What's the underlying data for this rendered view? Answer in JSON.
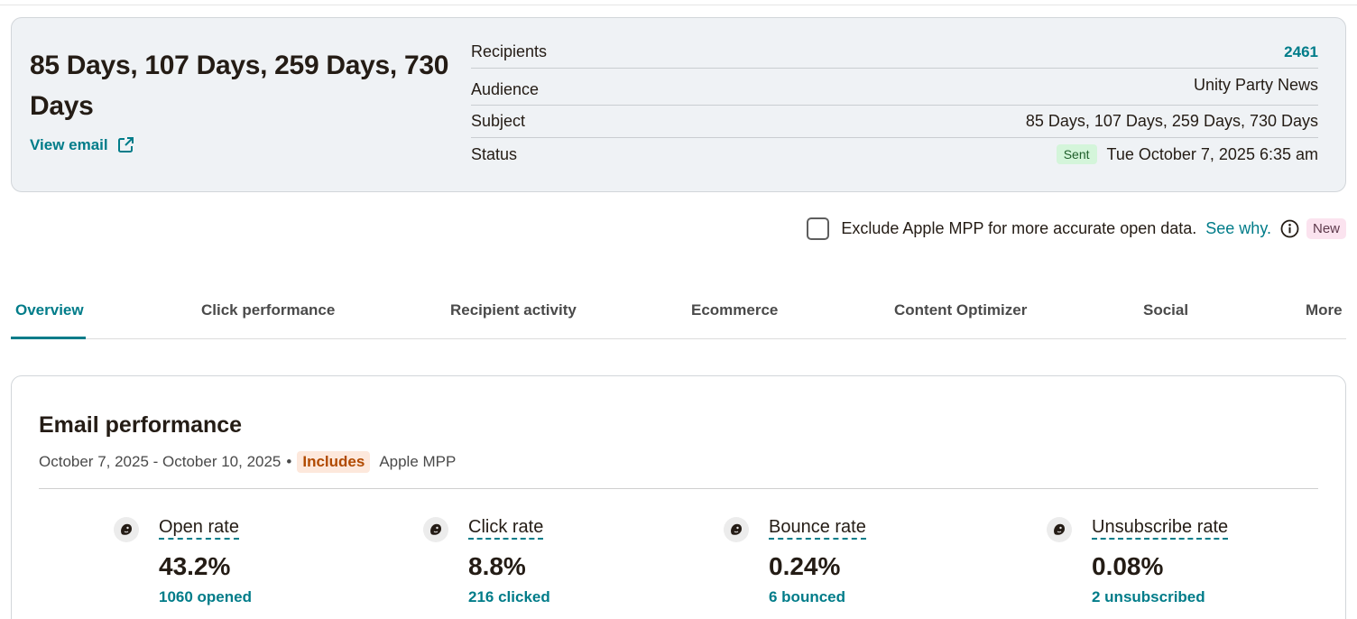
{
  "campaign": {
    "title": "85 Days, 107 Days, 259 Days, 730 Days",
    "view_email_label": "View email"
  },
  "details": {
    "recipients_label": "Recipients",
    "recipients_value": "2461",
    "audience_label": "Audience",
    "audience_value": "Unity Party News",
    "subject_label": "Subject",
    "subject_value": "85 Days, 107 Days, 259 Days, 730 Days",
    "status_label": "Status",
    "status_badge": "Sent",
    "status_value": "Tue October 7, 2025 6:35 am"
  },
  "mpp": {
    "text": "Exclude Apple MPP for more accurate open data.",
    "link": "See why.",
    "badge": "New",
    "checked": false
  },
  "tabs": [
    {
      "label": "Overview",
      "active": true
    },
    {
      "label": "Click performance"
    },
    {
      "label": "Recipient activity"
    },
    {
      "label": "Ecommerce"
    },
    {
      "label": "Content Optimizer"
    },
    {
      "label": "Social"
    },
    {
      "label": "More"
    }
  ],
  "performance": {
    "title": "Email performance",
    "date_range": "October 7, 2025 - October 10, 2025",
    "separator": "•",
    "includes_badge": "Includes",
    "includes_text": "Apple MPP",
    "metrics": [
      {
        "label": "Open rate",
        "value": "43.2%",
        "sub": "1060 opened"
      },
      {
        "label": "Click rate",
        "value": "8.8%",
        "sub": "216 clicked"
      },
      {
        "label": "Bounce rate",
        "value": "0.24%",
        "sub": "6 bounced"
      },
      {
        "label": "Unsubscribe rate",
        "value": "0.08%",
        "sub": "2 unsubscribed"
      }
    ]
  },
  "colors": {
    "accent": "#007c89",
    "card_bg": "#eff2f5",
    "sent_badge_bg": "#d4f5da",
    "includes_badge_bg": "#fde8dc",
    "new_badge_bg": "#fbe3ef"
  },
  "icons": {
    "view_email": "external-link-icon",
    "info": "info-icon",
    "metric_logo": "mailchimp-logo-icon"
  }
}
